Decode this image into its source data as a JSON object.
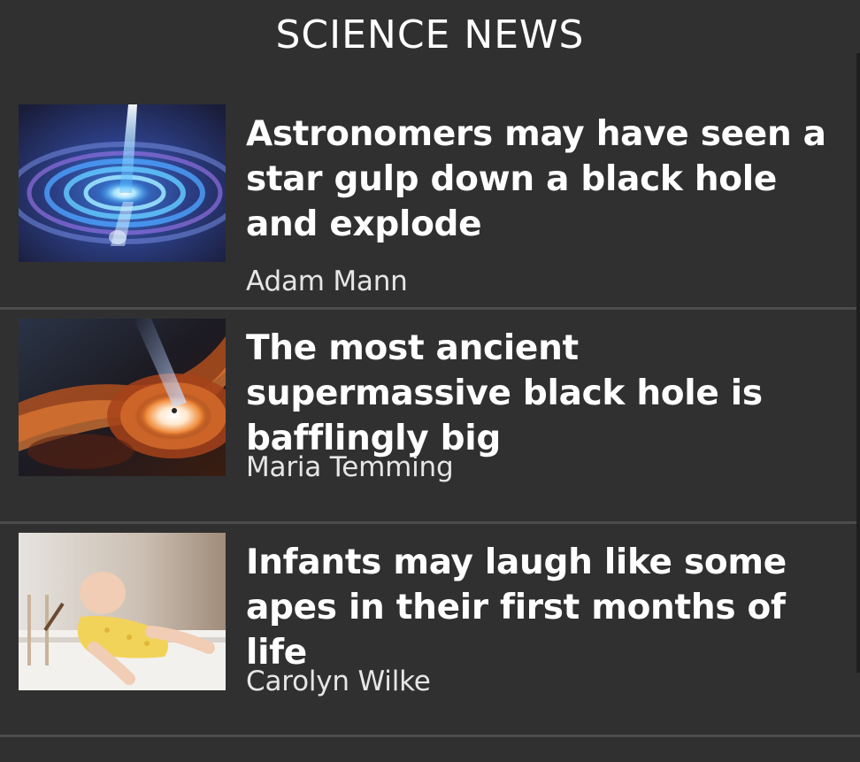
{
  "header": {
    "title": "SCIENCE NEWS"
  },
  "articles": [
    {
      "headline": "Astronomers may have seen a star gulp down a black hole and explode",
      "author": "Adam Mann",
      "thumbnail": "blue-spiral-galaxy-jet-image"
    },
    {
      "headline": "The most ancient supermassive black hole is bafflingly big",
      "author": "Maria Temming",
      "thumbnail": "orange-accretion-disk-black-hole-image"
    },
    {
      "headline": "Infants may laugh like some apes in their first months of life",
      "author": "Carolyn Wilke",
      "thumbnail": "laughing-infant-photo"
    }
  ],
  "colors": {
    "background": "#303030",
    "divider": "#4c4c4c",
    "text": "#ffffff",
    "author_text": "#e6e6e6"
  }
}
